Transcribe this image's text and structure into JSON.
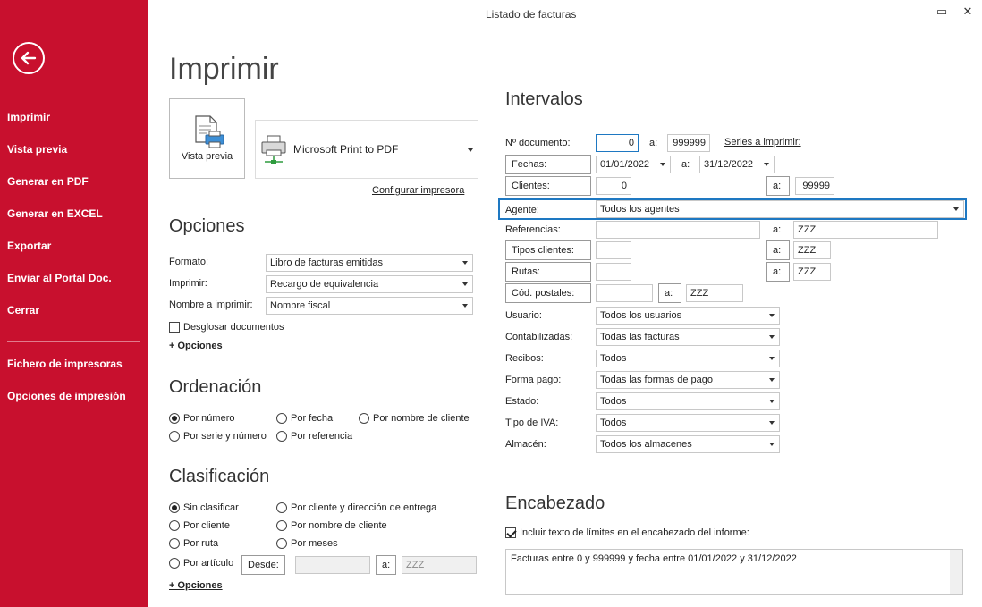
{
  "window": {
    "title": "Listado de facturas",
    "maximize_glyph": "▭",
    "close_glyph": "✕"
  },
  "sidebar": {
    "items": [
      {
        "label": "Imprimir"
      },
      {
        "label": "Vista previa"
      },
      {
        "label": "Generar en PDF"
      },
      {
        "label": "Generar en EXCEL"
      },
      {
        "label": "Exportar"
      },
      {
        "label": "Enviar al Portal Doc."
      },
      {
        "label": "Cerrar"
      },
      {
        "label": "Fichero de impresoras"
      },
      {
        "label": "Opciones de impresión"
      }
    ],
    "accent_color": "#c8102e"
  },
  "print": {
    "title": "Imprimir",
    "preview_label": "Vista previa",
    "printer": "Microsoft Print to PDF",
    "configure_link": "Configurar impresora"
  },
  "opciones": {
    "title": "Opciones",
    "formato_label": "Formato:",
    "formato_value": "Libro de facturas emitidas",
    "imprimir_label": "Imprimir:",
    "imprimir_value": "Recargo de equivalencia",
    "nombre_label": "Nombre a imprimir:",
    "nombre_value": "Nombre fiscal",
    "desglosar_label": "Desglosar documentos",
    "desglosar_checked": false,
    "more_link": "+ Opciones"
  },
  "ordenacion": {
    "title": "Ordenación",
    "options": [
      {
        "label": "Por número",
        "selected": true
      },
      {
        "label": "Por fecha",
        "selected": false
      },
      {
        "label": "Por nombre de cliente",
        "selected": false
      },
      {
        "label": "Por serie y número",
        "selected": false
      },
      {
        "label": "Por referencia",
        "selected": false
      }
    ]
  },
  "clasificacion": {
    "title": "Clasificación",
    "options": [
      {
        "label": "Sin clasificar",
        "selected": true
      },
      {
        "label": "Por cliente y dirección de entrega",
        "selected": false
      },
      {
        "label": "Por cliente",
        "selected": false
      },
      {
        "label": "Por nombre de cliente",
        "selected": false
      },
      {
        "label": "Por ruta",
        "selected": false
      },
      {
        "label": "Por meses",
        "selected": false
      },
      {
        "label": "Por artículo",
        "selected": false
      }
    ],
    "desde_label": "Desde:",
    "desde_value": "",
    "a_label": "a:",
    "a_value": "ZZZ",
    "more_link": "+ Opciones"
  },
  "intervalos": {
    "title": "Intervalos",
    "doc_label": "Nº documento:",
    "doc_from": "0",
    "doc_a": "a:",
    "doc_to": "999999",
    "series_link": "Series a imprimir:",
    "fechas_label": "Fechas:",
    "fecha_from": "01/01/2022",
    "fecha_a": "a:",
    "fecha_to": "31/12/2022",
    "clientes_label": "Clientes:",
    "clientes_from": "0",
    "clientes_a": "a:",
    "clientes_to": "99999",
    "agente_label": "Agente:",
    "agente_value": "Todos los agentes",
    "referencias_label": "Referencias:",
    "referencias_from": "",
    "referencias_a": "a:",
    "referencias_to": "ZZZ",
    "tipos_label": "Tipos clientes:",
    "tipos_from": "",
    "tipos_a": "a:",
    "tipos_to": "ZZZ",
    "rutas_label": "Rutas:",
    "rutas_from": "",
    "rutas_a": "a:",
    "rutas_to": "ZZZ",
    "cp_label": "Cód. postales:",
    "cp_from": "",
    "cp_a": "a:",
    "cp_to": "ZZZ",
    "usuario_label": "Usuario:",
    "usuario_value": "Todos los usuarios",
    "contab_label": "Contabilizadas:",
    "contab_value": "Todas las facturas",
    "recibos_label": "Recibos:",
    "recibos_value": "Todos",
    "forma_label": "Forma pago:",
    "forma_value": "Todas las formas de pago",
    "estado_label": "Estado:",
    "estado_value": "Todos",
    "iva_label": "Tipo de IVA:",
    "iva_value": "Todos",
    "almacen_label": "Almacén:",
    "almacen_value": "Todos los almacenes"
  },
  "encabezado": {
    "title": "Encabezado",
    "include_label": "Incluir texto de límites en el encabezado del informe:",
    "include_checked": true,
    "text": "Facturas entre 0 y 999999 y fecha entre 01/01/2022 y 31/12/2022"
  }
}
